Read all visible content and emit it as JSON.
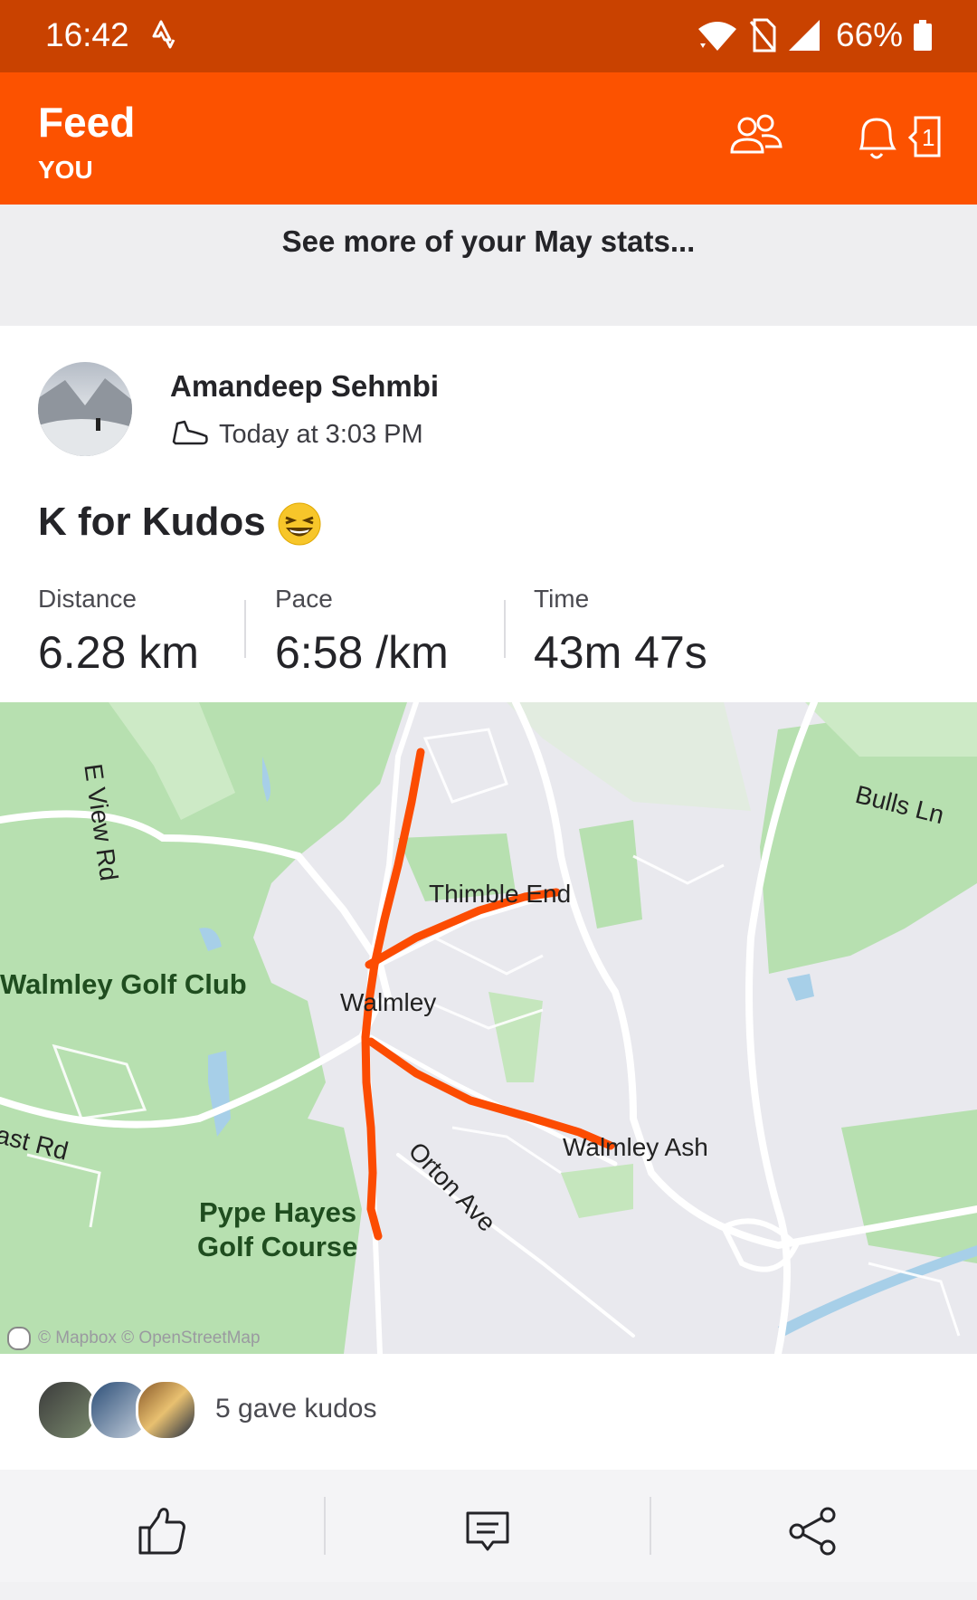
{
  "status_bar": {
    "time": "16:42",
    "battery": "66%",
    "icons": [
      "strava-activity-icon",
      "wifi-icon",
      "no-sim-icon",
      "signal-icon",
      "battery-icon"
    ]
  },
  "app_bar": {
    "title": "Feed",
    "subtitle": "YOU",
    "inbox_count": "1",
    "color": "#fc5200"
  },
  "banner": {
    "text": "See more of your May stats..."
  },
  "activity": {
    "athlete": "Amandeep Sehmbi",
    "when": "Today at 3:03 PM",
    "title": "K for Kudos",
    "title_emoji": "😆",
    "stats": [
      {
        "label": "Distance",
        "value": "6.28 km"
      },
      {
        "label": "Pace",
        "value": "6:58 /km"
      },
      {
        "label": "Time",
        "value": "43m 47s"
      }
    ]
  },
  "map": {
    "labels": {
      "e_view_rd": "E View Rd",
      "bulls_ln": "Bulls Ln",
      "thimble_end": "Thimble End",
      "walmley_golf": "Walmley Golf Club",
      "walmley": "Walmley",
      "east_rd": "ast Rd",
      "orton_ave": "Orton Ave",
      "walmley_ash": "Walmley Ash",
      "pype_hayes_1": "Pype Hayes",
      "pype_hayes_2": "Golf Course"
    },
    "attribution": "© Mapbox © OpenStreetMap",
    "route_color": "#fc4c02"
  },
  "kudos": {
    "text": "5 gave kudos"
  },
  "actions": {
    "icons": [
      "thumbs-up-icon",
      "comment-icon",
      "share-icon"
    ]
  }
}
